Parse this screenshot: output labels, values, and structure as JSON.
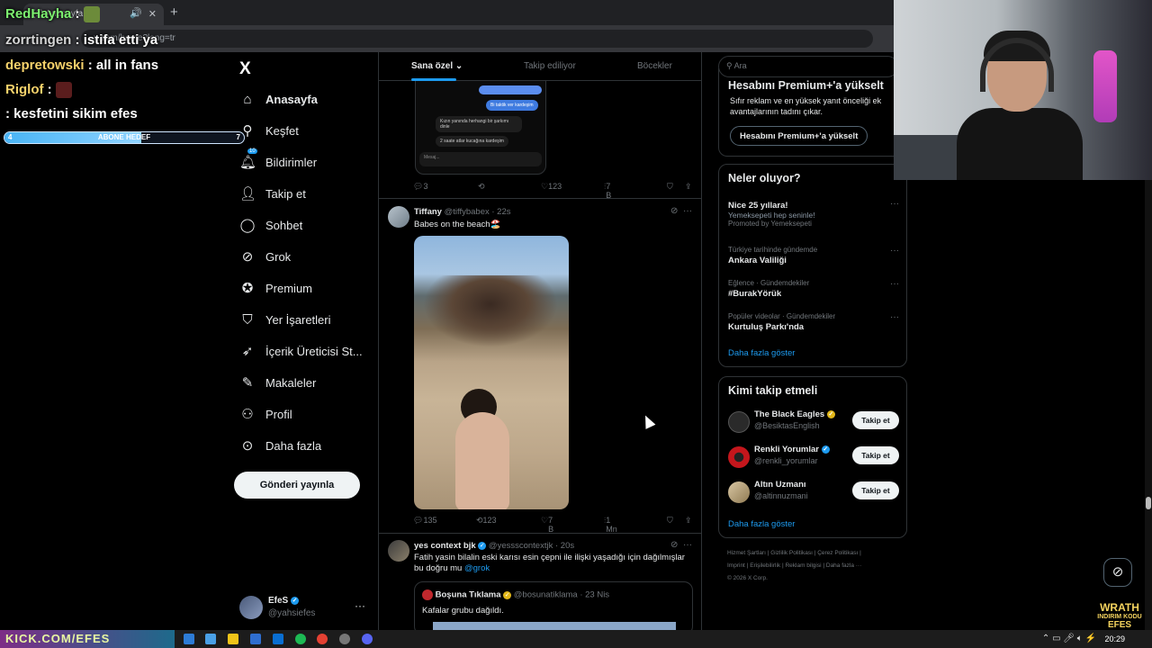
{
  "browser": {
    "tab_title": "(1) Anasayfa / X",
    "address": "x.com/home?lang=tr"
  },
  "nav": {
    "logo": "X",
    "items": [
      {
        "label": "Anasayfa",
        "icon": "home-icon"
      },
      {
        "label": "Keşfet",
        "icon": "search-icon"
      },
      {
        "label": "Bildirimler",
        "icon": "bell-icon",
        "badge": "10"
      },
      {
        "label": "Takip et",
        "icon": "follow-icon"
      },
      {
        "label": "Sohbet",
        "icon": "chat-icon"
      },
      {
        "label": "Grok",
        "icon": "grok-icon"
      },
      {
        "label": "Premium",
        "icon": "premium-icon"
      },
      {
        "label": "Yer İşaretleri",
        "icon": "bookmark-icon"
      },
      {
        "label": "İçerik Üreticisi St...",
        "icon": "rocket-icon"
      },
      {
        "label": "Makaleler",
        "icon": "article-icon"
      },
      {
        "label": "Profil",
        "icon": "profile-icon"
      },
      {
        "label": "Daha fazla",
        "icon": "more-icon"
      }
    ],
    "post_button": "Gönderi yayınla",
    "account_name": "EfeS",
    "account_handle": "@yahsiefes"
  },
  "feed": {
    "tabs": [
      "Sana özel",
      "Takip ediliyor",
      "Böcekler"
    ],
    "prev_tweet": {
      "bubbles": [
        "Bi taktik ver kardeşim",
        "Kızın yanında herhangi bir şarkımı dinle",
        "2 saate atlar kucağına kardeşim",
        "Mesaj..."
      ],
      "stats": {
        "reply": "3",
        "retweet": "",
        "like": "123",
        "views": "7 B"
      }
    },
    "tweet1": {
      "name": "Tiffany",
      "handle": "@tiffybabex · 22s",
      "text": "Babes on the beach🏖️",
      "stats": {
        "reply": "135",
        "retweet": "123",
        "like": "7 B",
        "views": "1 Mn"
      }
    },
    "tweet2": {
      "name": "yes context bjk",
      "handle": "@yessscontextjk · 20s",
      "text": "Fatih yasin bilalin eski karısı esin çepni ile ilişki yaşadığı için dağılmışlar bu doğru mu",
      "mention": "@grok",
      "quote_name": "Boşuna Tıklama",
      "quote_handle": "@bosunatiklama · 23 Nis",
      "quote_text": "Kafalar grubu dağıldı."
    }
  },
  "right": {
    "search_placeholder": "Ara",
    "premium": {
      "title": "Hesabını Premium+'a yükselt",
      "desc": "Sıfır reklam ve en yüksek yanıt önceliği ek avantajlarının tadını çıkar.",
      "button": "Hesabını Premium+'a yükselt"
    },
    "trends_title": "Neler oluyor?",
    "trends": [
      {
        "ctx": "",
        "title": "Nice 25 yıllara!",
        "sub": "Yemeksepeti hep seninle!",
        "sub2": "Promoted by Yemeksepeti"
      },
      {
        "ctx": "Türkiye tarihinde gündemde",
        "title": "Ankara Valiliği"
      },
      {
        "ctx": "Eğlence · Gündemdekiler",
        "title": "#BurakYörük"
      },
      {
        "ctx": "Popüler videolar · Gündemdekiler",
        "title": "Kurtuluş Parkı'nda"
      }
    ],
    "trends_more": "Daha fazla göster",
    "who_title": "Kimi takip etmeli",
    "who": [
      {
        "name": "The Black Eagles",
        "handle": "@BesiktasEnglish"
      },
      {
        "name": "Renkli Yorumlar",
        "handle": "@renkli_yorumlar"
      },
      {
        "name": "Altın Uzmanı",
        "handle": "@altinnuzmani"
      }
    ],
    "follow_label": "Takip et",
    "who_more": "Daha fazla göster",
    "footer": [
      "Hizmet Şartları",
      "Gizlilik Politikası",
      "Çerez Politikası",
      "Imprint",
      "Erişilebilirlik",
      "Reklam bilgisi",
      "Daha fazla ···",
      "© 2026 X Corp."
    ]
  },
  "overlay": {
    "chat": [
      {
        "user": "RedHayha",
        "msg": ""
      },
      {
        "user": "zorrtingen",
        "msg": "istifa etti ya"
      },
      {
        "user": "depretowski",
        "msg": "all in fans"
      },
      {
        "user": "Riglof",
        "msg": ""
      },
      {
        "user": "",
        "msg": "kesfetini sikim efes"
      }
    ],
    "sub_goal": {
      "label": "ABONE HEDEF",
      "left": "4",
      "right": "7",
      "progress": 0.57
    },
    "brand": [
      "WRATH",
      "INDIRIM KODU",
      "EFES"
    ],
    "banner": "KICK.COM/EFES"
  },
  "taskbar": {
    "time": "20:29"
  },
  "colors": {
    "accent": "#1d9bf0",
    "verified_gold": "#e2b719",
    "bg": "#000000"
  }
}
